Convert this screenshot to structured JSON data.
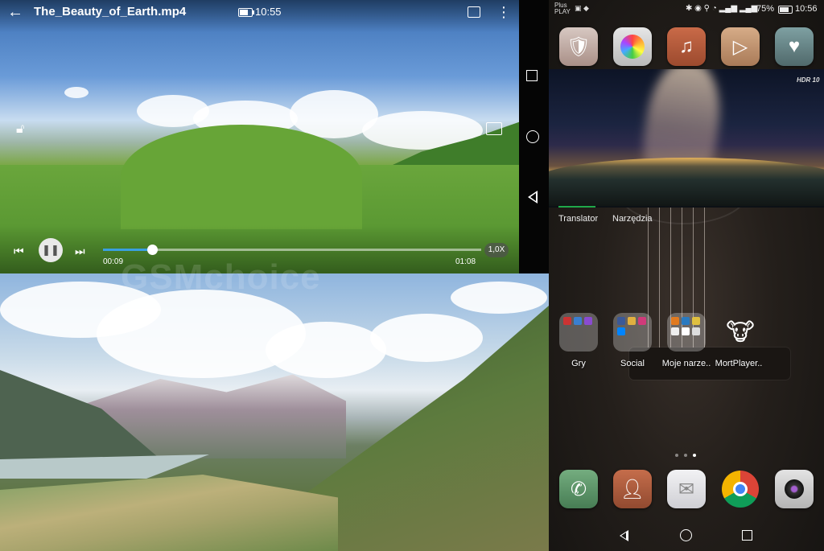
{
  "video_player": {
    "title": "The_Beauty_of_Earth.mp4",
    "clock": "10:55",
    "time_current": "00:09",
    "time_total": "01:08",
    "progress_fraction": 0.13,
    "speed": "1,0X",
    "icons": {
      "back": "back-arrow-icon",
      "battery": "battery-icon",
      "pip": "picture-in-picture-icon",
      "more": "more-vertical-icon",
      "lock": "unlock-icon",
      "fullscreen": "fullscreen-icon",
      "prev": "skip-previous-icon",
      "pause": "pause-icon",
      "next": "skip-next-icon"
    }
  },
  "watermark": "GSMchoice",
  "home": {
    "status": {
      "carrier_line1": "Plus",
      "carrier_line2": "PLAY",
      "battery_pct": "75%",
      "clock": "10:56"
    },
    "top_apps": [
      {
        "name": "shield-app-icon",
        "color": "#d7c8c2"
      },
      {
        "name": "theme-brush-app-icon",
        "color": "#d9d9d9"
      },
      {
        "name": "music-app-icon",
        "color": "#b65a3c"
      },
      {
        "name": "video-play-app-icon",
        "color": "#c79b78"
      },
      {
        "name": "health-app-icon",
        "color": "#6c8c8e"
      }
    ],
    "banner_hdr": "HDR 10",
    "widget_tabs": [
      "Translator",
      "Narzędzia"
    ],
    "folders": [
      {
        "label": "Gry"
      },
      {
        "label": "Social"
      },
      {
        "label": "Moje narze.."
      },
      {
        "label": "MortPlayer.."
      }
    ],
    "dock": [
      {
        "name": "phone-app-icon",
        "color": "#5d9a6a"
      },
      {
        "name": "contacts-app-icon",
        "color": "#b6623f"
      },
      {
        "name": "messages-app-icon",
        "color": "#e7e7ea"
      },
      {
        "name": "chrome-app-icon",
        "color": "#ffffff"
      },
      {
        "name": "camera-app-icon",
        "color": "#d8d8d8"
      }
    ]
  }
}
